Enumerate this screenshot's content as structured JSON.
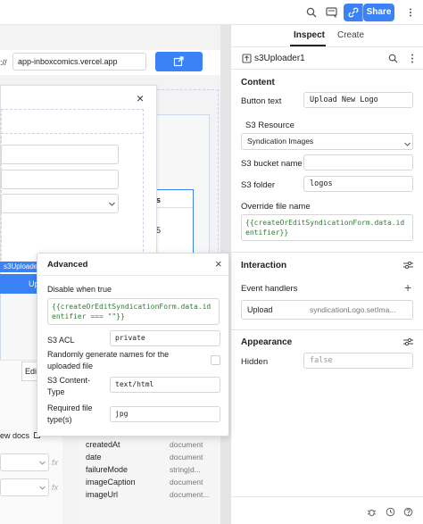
{
  "topbar": {
    "share_label": "Share",
    "icons": [
      "search-icon",
      "comment-icon",
      "permissions-icon"
    ]
  },
  "canvas": {
    "url_prefix": "://",
    "url_value": "app-inboxcomics.vercel.app",
    "modal_close": "×",
    "table_header_fragment": "s",
    "table_cell_fragment": "5",
    "component_badge": "s3Uploader1",
    "upload_fragment": "Up",
    "edit_fragment": "Edi",
    "docs_link": "ew docs",
    "schema": [
      {
        "name": "createdAt",
        "type": "document"
      },
      {
        "name": "date",
        "type": "document"
      },
      {
        "name": "failureMode",
        "type": "string|d..."
      },
      {
        "name": "imageCaption",
        "type": "document"
      },
      {
        "name": "imageUrl",
        "type": "document..."
      }
    ]
  },
  "panel": {
    "tabs": [
      "Inspect",
      "Create"
    ],
    "component_name": "s3Uploader1",
    "content_title": "Content",
    "button_text_label": "Button text",
    "button_text_value": "Upload New Logo",
    "s3_resource_label": "S3 Resource",
    "s3_resource_value": "Syndication Images",
    "bucket_label": "S3 bucket name",
    "bucket_value": "",
    "folder_label": "S3 folder",
    "folder_value": "logos",
    "override_label": "Override file name",
    "override_value": "{{createOrEditSyndicationForm.data.identifier}}",
    "interaction_title": "Interaction",
    "event_handlers_label": "Event handlers",
    "handler_event": "Upload",
    "handler_action": "syndicationLogo.setIma...",
    "appearance_title": "Appearance",
    "hidden_label": "Hidden",
    "hidden_placeholder": "false"
  },
  "advanced": {
    "title": "Advanced",
    "close": "×",
    "disable_label": "Disable when true",
    "disable_code": "{{createOrEditSyndicationForm.data.identifier === \"\"}}",
    "acl_label": "S3 ACL",
    "acl_placeholder": "private",
    "random_label": "Randomly generate names for the uploaded file",
    "content_type_label": "S3 Content-Type",
    "content_type_placeholder": "text/html",
    "required_label": "Required file type(s)",
    "required_value": "jpg"
  },
  "colors": {
    "accent": "#3b82f6",
    "code_green": "#2e7d32",
    "code_blue": "#1d4ed8"
  }
}
